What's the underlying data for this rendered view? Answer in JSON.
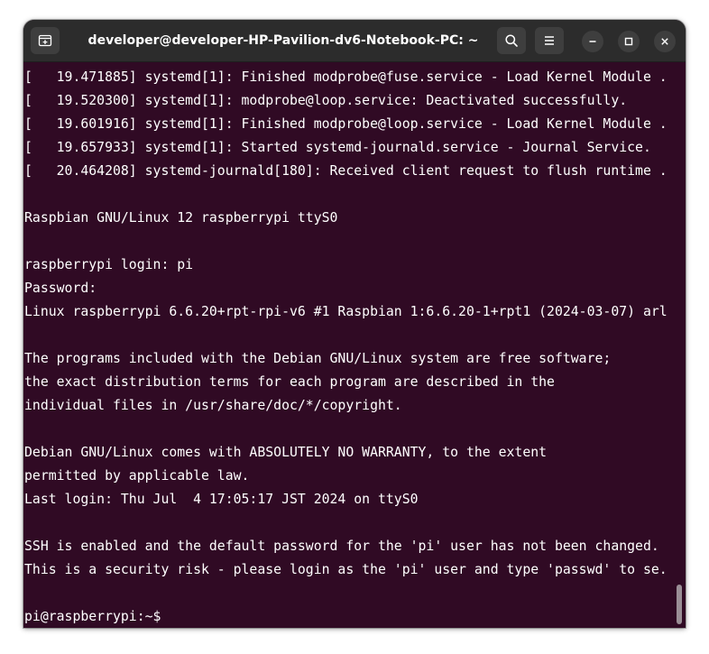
{
  "window": {
    "title": "developer@developer-HP-Pavilion-dv6-Notebook-PC: ~"
  },
  "icons": {
    "new_tab": "new-tab-icon",
    "search": "search-icon",
    "menu": "hamburger-menu-icon",
    "minimize": "minimize-icon",
    "maximize": "maximize-icon",
    "close": "close-icon"
  },
  "colors": {
    "terminal_background": "#300a24",
    "titlebar_background": "#2c2c2c",
    "text": "#ffffff"
  },
  "terminal": {
    "lines": [
      "[   19.471885] systemd[1]: Finished modprobe@fuse.service - Load Kernel Module .",
      "[   19.520300] systemd[1]: modprobe@loop.service: Deactivated successfully.",
      "[   19.601916] systemd[1]: Finished modprobe@loop.service - Load Kernel Module .",
      "[   19.657933] systemd[1]: Started systemd-journald.service - Journal Service.",
      "[   20.464208] systemd-journald[180]: Received client request to flush runtime .",
      "",
      "Raspbian GNU/Linux 12 raspberrypi ttyS0",
      "",
      "raspberrypi login: pi",
      "Password:",
      "Linux raspberrypi 6.6.20+rpt-rpi-v6 #1 Raspbian 1:6.6.20-1+rpt1 (2024-03-07) arl",
      "",
      "The programs included with the Debian GNU/Linux system are free software;",
      "the exact distribution terms for each program are described in the",
      "individual files in /usr/share/doc/*/copyright.",
      "",
      "Debian GNU/Linux comes with ABSOLUTELY NO WARRANTY, to the extent",
      "permitted by applicable law.",
      "Last login: Thu Jul  4 17:05:17 JST 2024 on ttyS0",
      "",
      "SSH is enabled and the default password for the 'pi' user has not been changed.",
      "This is a security risk - please login as the 'pi' user and type 'passwd' to se.",
      "",
      "pi@raspberrypi:~$"
    ]
  }
}
